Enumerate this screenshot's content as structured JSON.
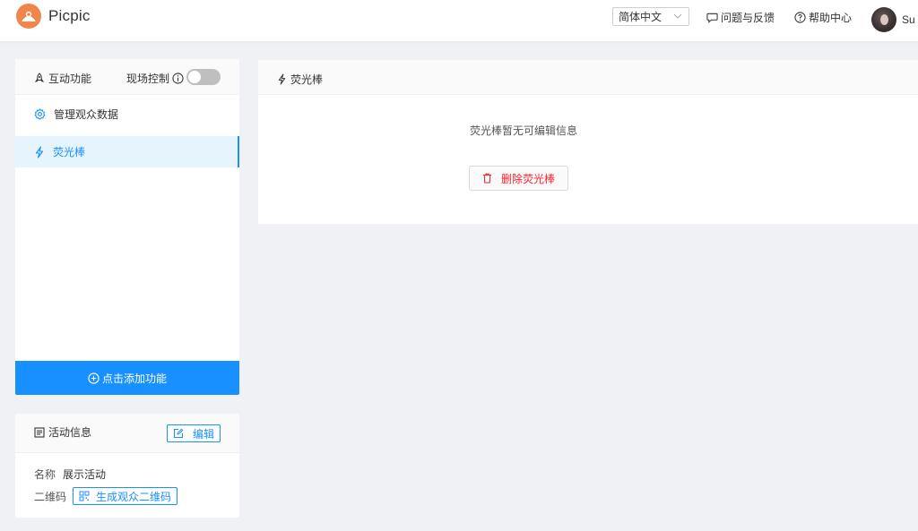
{
  "header": {
    "brand": "Picpic",
    "language": "简体中文",
    "feedback": "问题与反馈",
    "help": "帮助中心",
    "user": "Su"
  },
  "features": {
    "title": "互动功能",
    "live_control": "现场控制",
    "live_control_on": false,
    "items": [
      {
        "label": "管理观众数据",
        "icon": "gear-icon",
        "active": false
      },
      {
        "label": "荧光棒",
        "icon": "lightning-icon",
        "active": true
      }
    ],
    "add_button": "点击添加功能"
  },
  "activity": {
    "title": "活动信息",
    "edit": "编辑",
    "name_label": "名称",
    "name_value": "展示活动",
    "qr_label": "二维码",
    "qr_button": "生成观众二维码"
  },
  "main": {
    "title": "荧光棒",
    "message": "荧光棒暂无可编辑信息",
    "delete_button": "删除荧光棒"
  },
  "colors": {
    "accent": "#1890ff",
    "danger": "#f5222d",
    "logo": "#f0864a",
    "background": "#f0f1f5"
  }
}
